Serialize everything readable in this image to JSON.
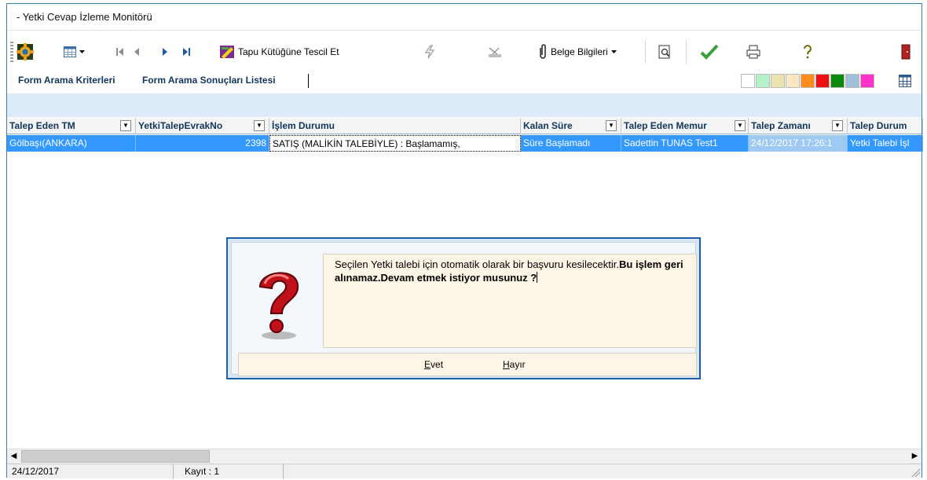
{
  "window": {
    "title": "- Yetki Cevap İzleme Monitörü"
  },
  "toolbar": {
    "tescil_label": "Tapu Kütüğüne Tescil Et",
    "belge_label": "Belge Bilgileri"
  },
  "tabs": {
    "criteria": "Form Arama Kriterleri",
    "results": "Form Arama Sonuçları Listesi"
  },
  "swatch_colors": [
    "#ffffff",
    "#b6f2c9",
    "#e9e3b0",
    "#fde7c2",
    "#ff8c1a",
    "#ee1111",
    "#0a8a0a",
    "#9fbfdb",
    "#ff33cc"
  ],
  "grid": {
    "columns": [
      "Talep Eden TM",
      "YetkiTalepEvrakNo",
      "İşlem Durumu",
      "Kalan Süre",
      "Talep Eden Memur",
      "Talep Zamanı",
      "Talep Durum"
    ],
    "row": {
      "talep_eden_tm": "Gölbaşı(ANKARA)",
      "evrak_no": "2398",
      "islem_durumu": "SATIŞ (MALİKİN TALEBİYLE) : Başlamamış,",
      "kalan_sure": "Süre Başlamadı",
      "talep_eden_memur": "Sadettin TUNAS Test1",
      "talep_zamani": "24/12/2017 17:26:1",
      "talep_durumu": "Yetki Talebi İşl"
    }
  },
  "status": {
    "date": "24/12/2017",
    "kayit": "Kayıt : 1"
  },
  "dialog": {
    "message_normal": " Seçilen Yetki talebi için otomatik olarak bir başvuru kesilecektir.",
    "message_bold": "Bu işlem geri alınamaz.Devam etmek istiyor musunuz ?",
    "yes_label": "Evet",
    "no_label": "Hayır"
  }
}
